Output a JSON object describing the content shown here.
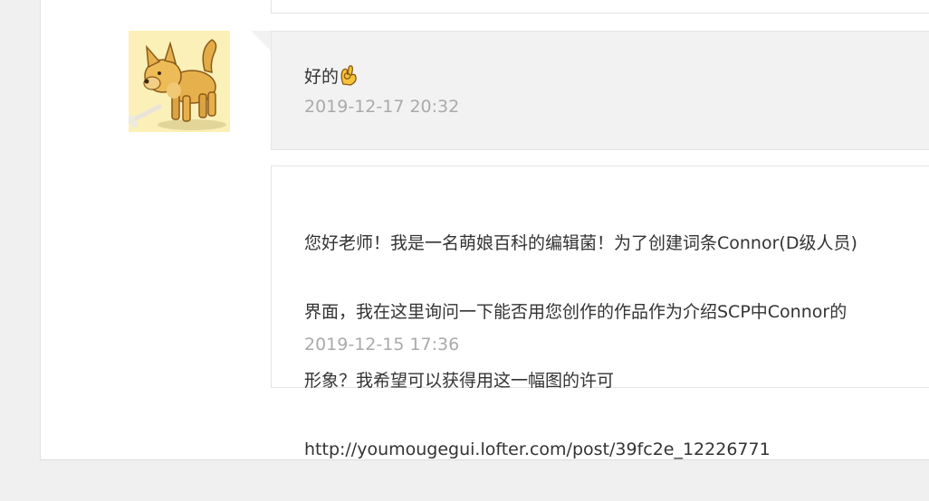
{
  "conversation": {
    "messages": [
      {
        "direction": "received",
        "text": "好的",
        "emoji": "ok-hand-icon",
        "time": "2019-12-17 20:32"
      },
      {
        "direction": "sent",
        "lines": [
          "您好老师！我是一名萌娘百科的编辑菌！为了创建词条Connor(D级人员)",
          "界面，我在这里询问一下能否用您创作的作品作为介绍SCP中Connor的",
          "形象？我希望可以获得用这一幅图的许可",
          "http://youmougegui.lofter.com/post/39fc2e_12226771"
        ],
        "time": "2019-12-15 17:36"
      }
    ]
  },
  "colors": {
    "page_bg": "#f0f0f0",
    "panel_bg": "#ffffff",
    "received_bubble_bg": "#f2f2f2",
    "text": "#333333",
    "timestamp": "#aaaaaa",
    "border": "#e3e3e3"
  }
}
